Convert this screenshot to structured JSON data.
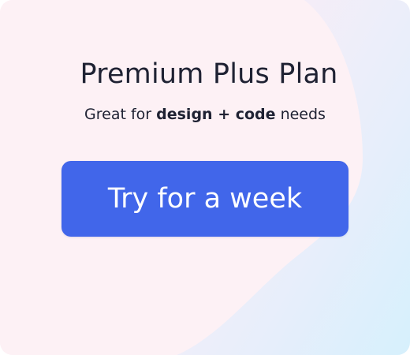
{
  "plan": {
    "title": "Premium Plus Plan",
    "subtitle": {
      "prefix": "Great for ",
      "highlight": "design + code",
      "suffix": " needs"
    },
    "cta_label": "Try for a week"
  },
  "colors": {
    "cta_background": "#4166ea",
    "cta_text": "#ffffff",
    "text": "#1f2233",
    "background_pink": "#fdeff3",
    "background_blue": "#d6f0fc",
    "blob": "#fdf1f5"
  }
}
